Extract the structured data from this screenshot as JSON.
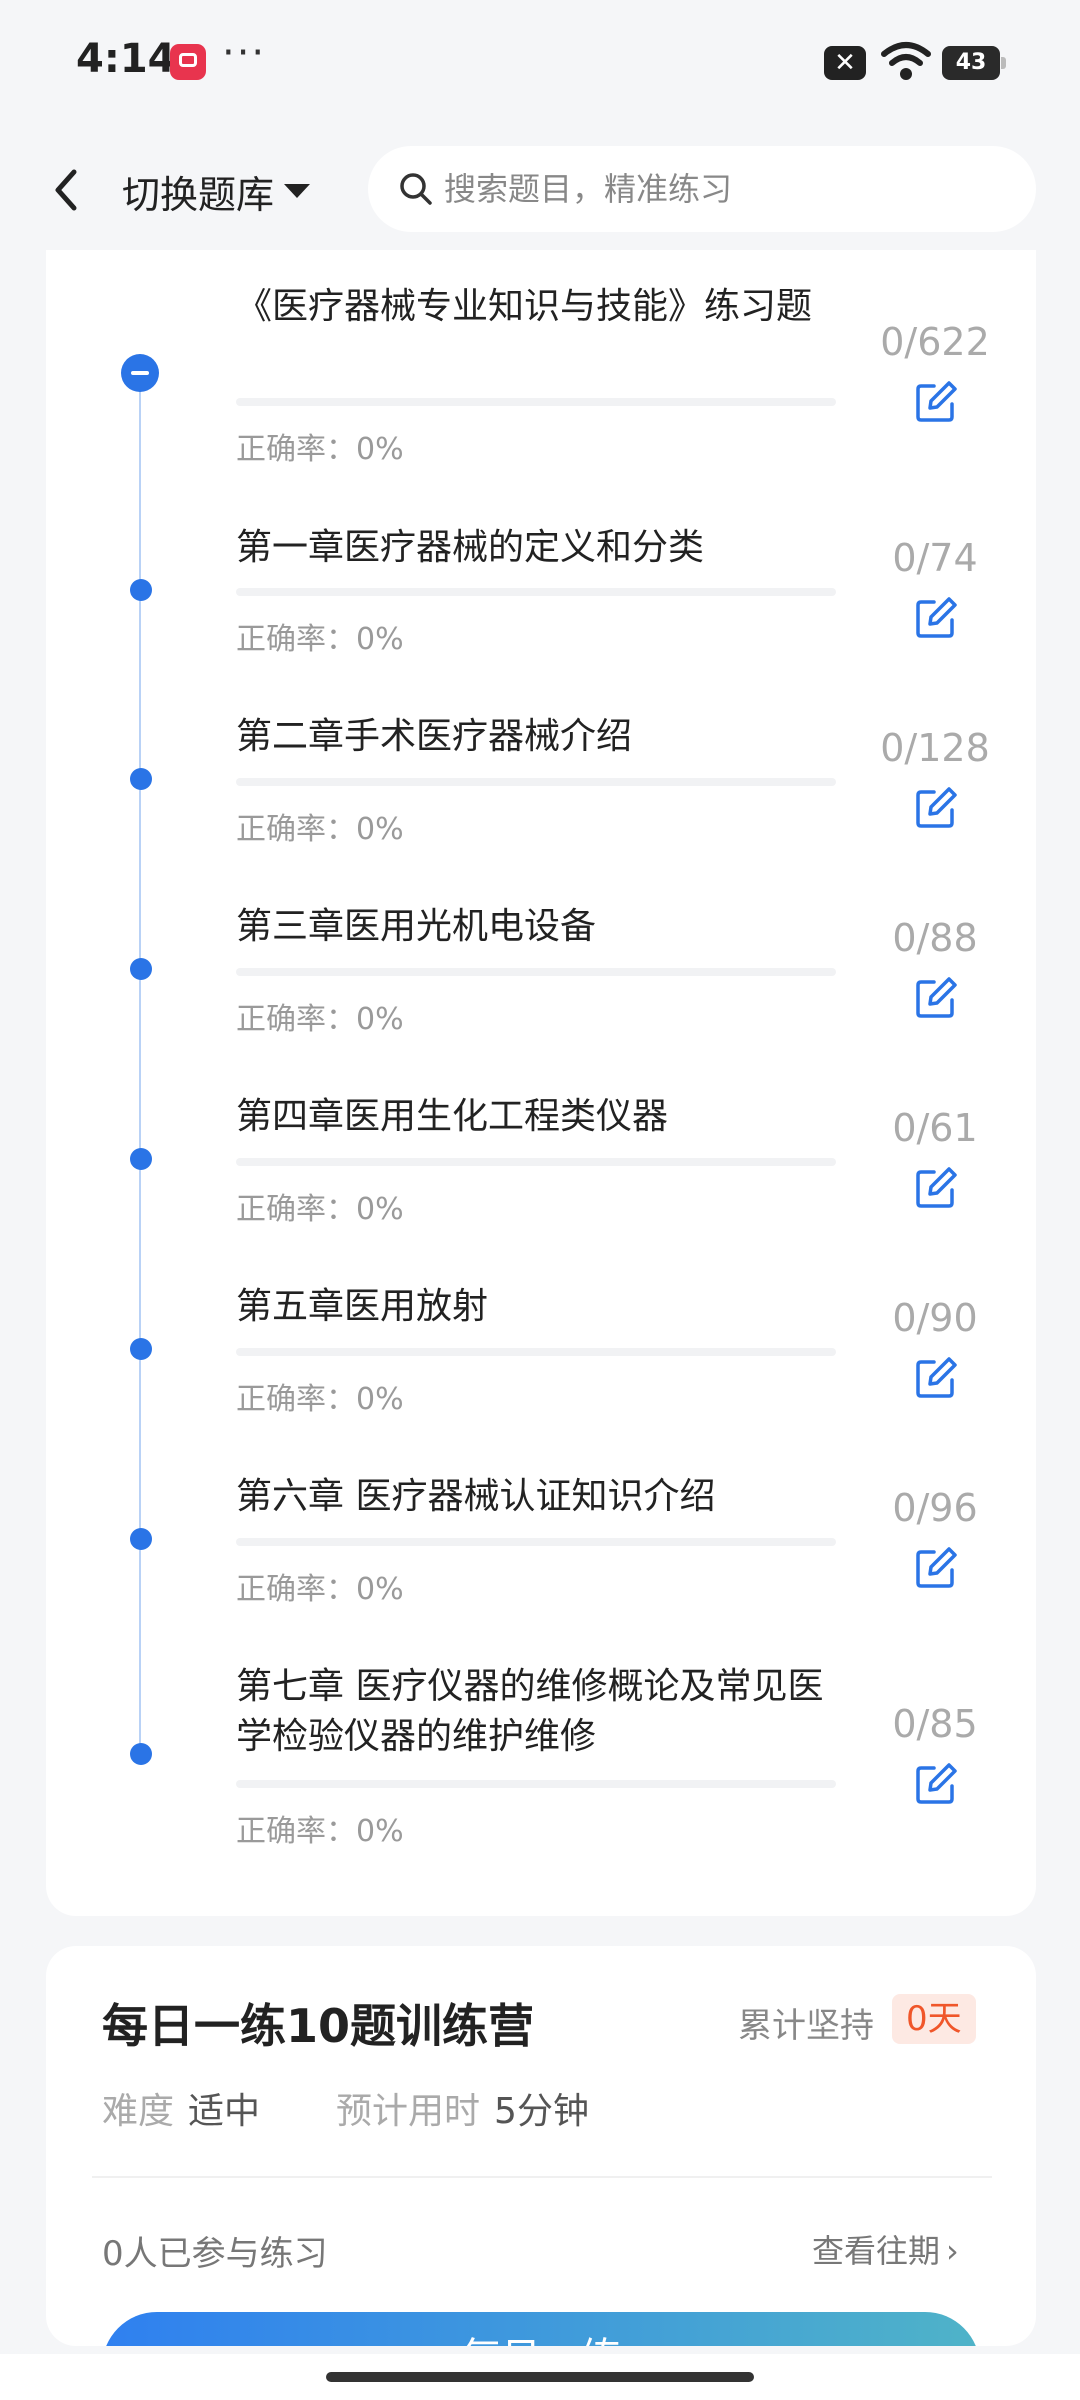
{
  "status_bar": {
    "time": "4:14",
    "dots": "···",
    "battery": "43",
    "icons": [
      "app-notification-icon",
      "close-badge-icon",
      "wifi-icon",
      "battery-icon"
    ]
  },
  "header": {
    "switch_bank_label": "切换题库",
    "search_placeholder": "搜索题目，精准练习",
    "icons": [
      "back-icon",
      "caret-down-icon",
      "search-icon"
    ]
  },
  "chapters": [
    {
      "title": "《医疗器械专业知识与技能》练习题",
      "count": "0/622",
      "accuracy": "正确率：0%",
      "progress": 0
    },
    {
      "title": "第一章医疗器械的定义和分类",
      "count": "0/74",
      "accuracy": "正确率：0%",
      "progress": 0
    },
    {
      "title": "第二章手术医疗器械介绍",
      "count": "0/128",
      "accuracy": "正确率：0%",
      "progress": 0
    },
    {
      "title": "第三章医用光机电设备",
      "count": "0/88",
      "accuracy": "正确率：0%",
      "progress": 0
    },
    {
      "title": "第四章医用生化工程类仪器",
      "count": "0/61",
      "accuracy": "正确率：0%",
      "progress": 0
    },
    {
      "title": "第五章医用放射",
      "count": "0/90",
      "accuracy": "正确率：0%",
      "progress": 0
    },
    {
      "title": "第六章 医疗器械认证知识介绍",
      "count": "0/96",
      "accuracy": "正确率：0%",
      "progress": 0
    },
    {
      "title": "第七章 医疗仪器的维修概论及常见医学检验仪器的维护维修",
      "count": "0/85",
      "accuracy": "正确率：0%",
      "progress": 0
    }
  ],
  "training": {
    "title": "每日一练10题训练营",
    "streak_label": "累计坚持",
    "streak_value": "0天",
    "difficulty_label": "难度",
    "difficulty_value": "适中",
    "time_label": "预计用时",
    "time_value": "5分钟",
    "participants": "0人已参与练习",
    "history_link": "查看往期",
    "history_chevron": "›",
    "button_label": "每日一练"
  },
  "colors": {
    "accent": "#2a74e6",
    "streak": "#f0562a",
    "background": "#f5f6f8"
  }
}
